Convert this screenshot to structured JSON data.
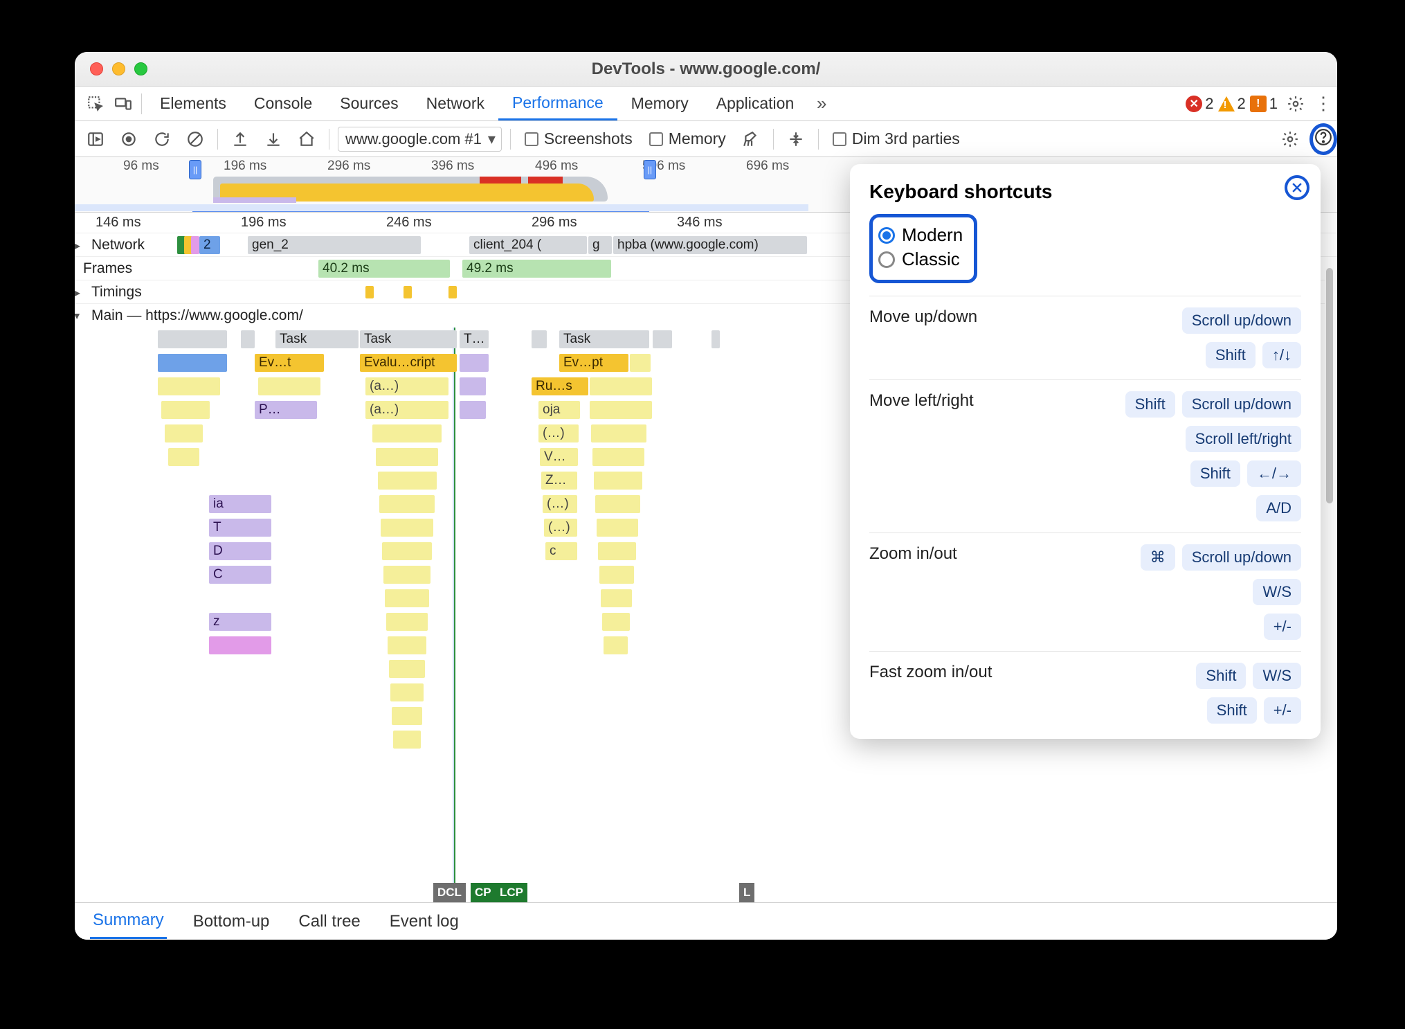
{
  "window_title": "DevTools - www.google.com/",
  "panel_tabs": [
    "Elements",
    "Console",
    "Sources",
    "Network",
    "Performance",
    "Memory",
    "Application"
  ],
  "active_panel_tab": "Performance",
  "badges": {
    "errors": "2",
    "warnings": "2",
    "issues": "1"
  },
  "toolbar": {
    "recording_select": "www.google.com #1",
    "screenshots_label": "Screenshots",
    "memory_label": "Memory",
    "dim_label": "Dim 3rd parties"
  },
  "overview_ticks": [
    "96 ms",
    "196 ms",
    "296 ms",
    "396 ms",
    "496 ms",
    "596 ms",
    "696 ms"
  ],
  "ruler2_ticks": [
    "146 ms",
    "196 ms",
    "246 ms",
    "296 ms",
    "346 ms"
  ],
  "tracks": {
    "network_label": "Network",
    "network_items": {
      "two": "2",
      "gen2": "gen_2",
      "client": "client_204 (",
      "g": "g",
      "hpba": "hpba (www.google.com)"
    },
    "frames_label": "Frames",
    "frames_items": {
      "a": "40.2 ms",
      "b": "49.2 ms"
    },
    "timings_label": "Timings",
    "main_label": "Main — https://www.google.com/"
  },
  "flame": {
    "row0": {
      "task1": "Task",
      "task2": "Task",
      "task3": "T…",
      "task4": "Task"
    },
    "row1": {
      "a": "Ev…t",
      "b": "Evalu…cript",
      "c": "Ev…pt"
    },
    "row2": {
      "a": "(a…)",
      "b": "Ru…s"
    },
    "row3": {
      "a": "P…",
      "b": "(a…)",
      "c": "oja"
    },
    "row4": {
      "a": "(…)"
    },
    "row5": {
      "a": "V…"
    },
    "row6": {
      "a": "Z…"
    },
    "row7": {
      "a": "ia",
      "b": "(…)"
    },
    "row8": {
      "a": "T",
      "b": "(…)"
    },
    "row9": {
      "a": "D",
      "b": "c"
    },
    "row10": {
      "a": "C"
    },
    "row11": {
      "a": "z"
    }
  },
  "markers": {
    "dcl": "DCL",
    "cp": "CP",
    "lcp": "LCP",
    "l": "L"
  },
  "bottom_tabs": [
    "Summary",
    "Bottom-up",
    "Call tree",
    "Event log"
  ],
  "popover": {
    "title": "Keyboard shortcuts",
    "radio_modern": "Modern",
    "radio_classic": "Classic",
    "rows": [
      {
        "name": "Move up/down",
        "keys": [
          [
            "Scroll up/down"
          ],
          [
            "Shift",
            "↑/↓"
          ]
        ]
      },
      {
        "name": "Move left/right",
        "keys": [
          [
            "Shift",
            "Scroll up/down"
          ],
          [
            "Scroll left/right"
          ],
          [
            "Shift",
            "←/→"
          ],
          [
            "A/D"
          ]
        ]
      },
      {
        "name": "Zoom in/out",
        "keys": [
          [
            "⌘",
            "Scroll up/down"
          ],
          [
            "W/S"
          ],
          [
            "+/-"
          ]
        ]
      },
      {
        "name": "Fast zoom in/out",
        "keys": [
          [
            "Shift",
            "W/S"
          ],
          [
            "Shift",
            "+/-"
          ]
        ]
      }
    ]
  }
}
